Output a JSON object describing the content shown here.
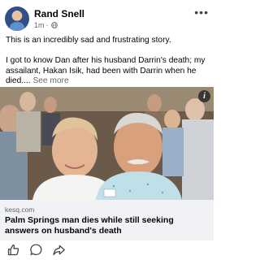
{
  "post": {
    "author": "Rand Snell",
    "time": "1m",
    "separator": "·",
    "text_line1": "This is an incredibly sad and frustrating story.",
    "text_line2": "I got to know Dan after his husband Darrin's death; my assailant, Hakan Isik, had been with Darrin when he died....",
    "see_more": "See more"
  },
  "link": {
    "domain": "kesq.com",
    "title": "Palm Springs man dies while still seeking answers on husband's death",
    "info": "i"
  },
  "icons": [
    "globe-icon",
    "more-options-icon",
    "info-icon",
    "like-icon",
    "comment-icon",
    "share-icon"
  ]
}
